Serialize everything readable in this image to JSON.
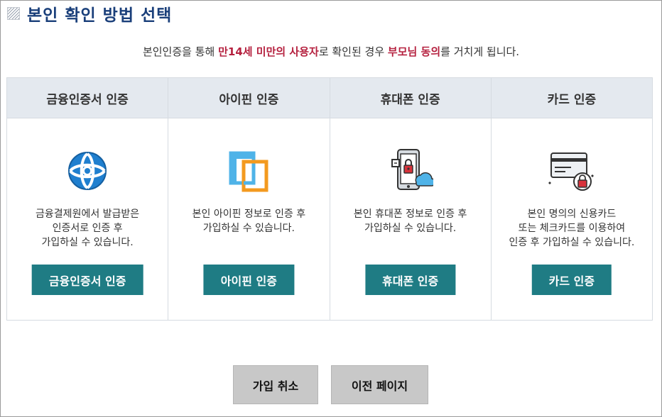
{
  "page": {
    "title": "본인 확인 방법 선택"
  },
  "notice": {
    "part1": "본인인증을 통해 ",
    "highlight1": "만14세 미만의 사용자",
    "part2": "로 확인된 경우 ",
    "highlight2": "부모님 동의",
    "part3": "를 거치게 됩니다."
  },
  "methods": [
    {
      "title": "금융인증서 인증",
      "icon": "financial-certificate-icon",
      "description": "금융결제원에서 발급받은\n인증서로 인증 후\n가입하실 수 있습니다.",
      "button": "금융인증서 인증"
    },
    {
      "title": "아이핀 인증",
      "icon": "ipin-icon",
      "description": "본인 아이핀 정보로 인증 후\n가입하실 수 있습니다.",
      "button": "아이핀 인증"
    },
    {
      "title": "휴대폰 인증",
      "icon": "mobile-phone-icon",
      "description": "본인 휴대폰 정보로 인증 후\n가입하실 수 있습니다.",
      "button": "휴대폰 인증"
    },
    {
      "title": "카드 인증",
      "icon": "credit-card-icon",
      "description": "본인 명의의 신용카드\n또는 체크카드를 이용하여\n인증 후 가입하실 수 있습니다.",
      "button": "카드 인증"
    }
  ],
  "actions": {
    "cancel": "가입 취소",
    "previous": "이전 페이지"
  },
  "colors": {
    "title": "#1a3f7a",
    "highlight": "#b5213f",
    "button": "#1f7c84",
    "header_bg": "#e4e9ef",
    "bottom_button": "#c8c8c8"
  }
}
